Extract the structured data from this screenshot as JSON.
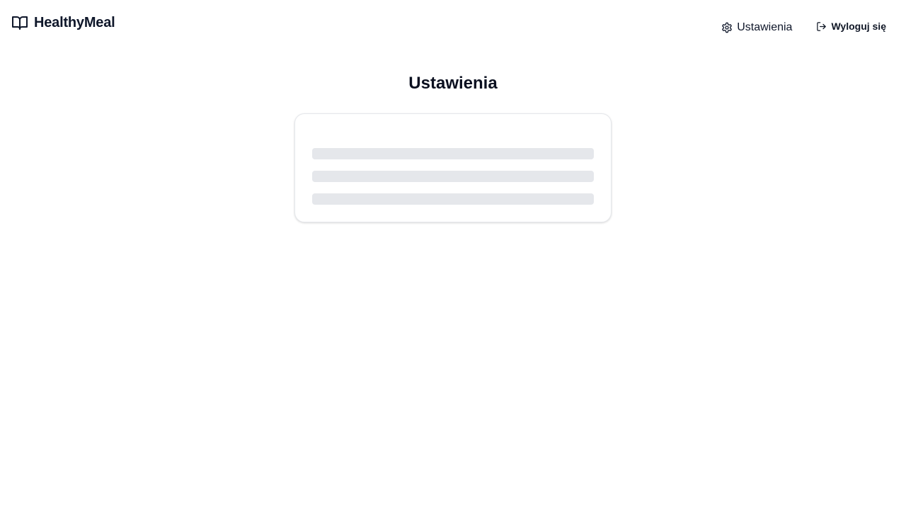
{
  "header": {
    "brand": {
      "icon": "book-open-icon",
      "name": "HealthyMeal"
    },
    "nav": {
      "settings": {
        "icon": "gear-icon",
        "label": "Ustawienia"
      },
      "logout": {
        "icon": "logout-icon",
        "label": "Wyloguj się"
      }
    }
  },
  "main": {
    "title": "Ustawienia",
    "card": {
      "state": "loading",
      "skeleton_rows": 3
    }
  },
  "colors": {
    "text": "#0f172a",
    "card_border": "#e5e7eb",
    "skeleton": "#e5e7eb",
    "background": "#ffffff"
  }
}
